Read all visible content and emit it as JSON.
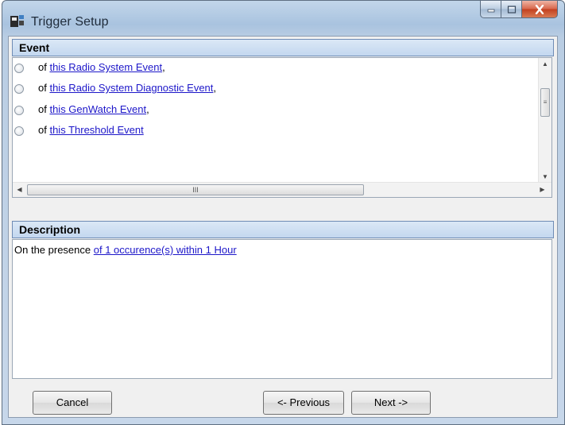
{
  "window": {
    "title": "Trigger Setup"
  },
  "event_section": {
    "header": "Event",
    "items": [
      {
        "prefix": "of",
        "link": "this Radio System Event",
        "suffix": ","
      },
      {
        "prefix": "of",
        "link": "this Radio System Diagnostic Event",
        "suffix": ","
      },
      {
        "prefix": "of",
        "link": "this GenWatch Event",
        "suffix": ","
      },
      {
        "prefix": "of",
        "link": "this Threshold Event",
        "suffix": ""
      }
    ],
    "hscroll_grip": "III"
  },
  "description_section": {
    "header": "Description",
    "prefix": "On the presence",
    "link": "of 1 occurence(s) within 1 Hour"
  },
  "buttons": {
    "cancel": "Cancel",
    "previous": "<- Previous",
    "next": "Next ->"
  },
  "colors": {
    "link": "#1d17c9",
    "header_bg": "#c3d7ef",
    "close_button": "#c2401f"
  },
  "icons": [
    "app-icon",
    "minimize-icon",
    "maximize-icon",
    "close-icon",
    "scroll-up-arrow-icon",
    "scroll-down-arrow-icon",
    "scroll-left-arrow-icon",
    "scroll-right-arrow-icon"
  ]
}
